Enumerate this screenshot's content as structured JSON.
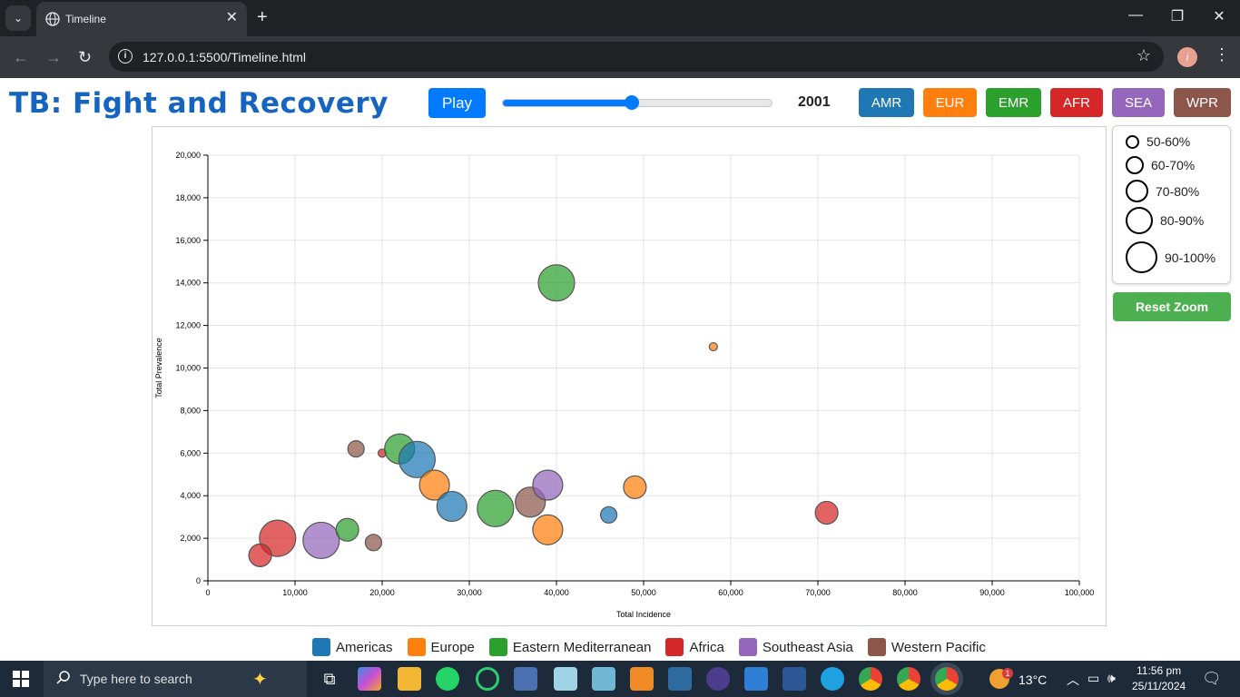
{
  "browser": {
    "tab_title": "Timeline",
    "url": "127.0.0.1:5500/Timeline.html"
  },
  "app": {
    "title": "TB: Fight and Recovery",
    "play_label": "Play",
    "year": "2001",
    "slider_fraction": 0.48,
    "reset_label": "Reset Zoom",
    "region_buttons": [
      {
        "label": "AMR",
        "color": "#1f77b4"
      },
      {
        "label": "EUR",
        "color": "#ff7f0e"
      },
      {
        "label": "EMR",
        "color": "#2ca02c"
      },
      {
        "label": "AFR",
        "color": "#d62728"
      },
      {
        "label": "SEA",
        "color": "#9467bd"
      },
      {
        "label": "WPR",
        "color": "#8c564b"
      }
    ],
    "size_legend": [
      "50-60%",
      "60-70%",
      "70-80%",
      "80-90%",
      "90-100%"
    ],
    "color_legend": [
      {
        "label": "Americas",
        "color": "#1f77b4"
      },
      {
        "label": "Europe",
        "color": "#ff7f0e"
      },
      {
        "label": "Eastern Mediterranean",
        "color": "#2ca02c"
      },
      {
        "label": "Africa",
        "color": "#d62728"
      },
      {
        "label": "Southeast Asia",
        "color": "#9467bd"
      },
      {
        "label": "Western Pacific",
        "color": "#8c564b"
      }
    ]
  },
  "chart_data": {
    "type": "scatter",
    "xlabel": "Total Incidence",
    "ylabel": "Total Prevalence",
    "xlim": [
      0,
      100000
    ],
    "ylim": [
      0,
      20000
    ],
    "grid": true,
    "x_ticks": [
      "0",
      "10,000",
      "20,000",
      "30,000",
      "40,000",
      "50,000",
      "60,000",
      "70,000",
      "80,000",
      "90,000",
      "100,000"
    ],
    "y_ticks": [
      "0",
      "2,000",
      "4,000",
      "6,000",
      "8,000",
      "10,000",
      "12,000",
      "14,000",
      "16,000",
      "18,000",
      "20,000"
    ],
    "points": [
      {
        "region": "EMR",
        "x": 40000,
        "y": 14000,
        "size": 5
      },
      {
        "region": "EUR",
        "x": 58000,
        "y": 11000,
        "size": 1
      },
      {
        "region": "WPR",
        "x": 17000,
        "y": 6200,
        "size": 2
      },
      {
        "region": "AFR",
        "x": 20000,
        "y": 6000,
        "size": 1
      },
      {
        "region": "EMR",
        "x": 22000,
        "y": 6200,
        "size": 4
      },
      {
        "region": "AMR",
        "x": 24000,
        "y": 5700,
        "size": 5
      },
      {
        "region": "EUR",
        "x": 26000,
        "y": 4500,
        "size": 4
      },
      {
        "region": "AMR",
        "x": 28000,
        "y": 3500,
        "size": 4
      },
      {
        "region": "EMR",
        "x": 33000,
        "y": 3400,
        "size": 5
      },
      {
        "region": "WPR",
        "x": 37000,
        "y": 3700,
        "size": 4
      },
      {
        "region": "SEA",
        "x": 39000,
        "y": 4500,
        "size": 4
      },
      {
        "region": "EUR",
        "x": 39000,
        "y": 2400,
        "size": 4
      },
      {
        "region": "AMR",
        "x": 46000,
        "y": 3100,
        "size": 2
      },
      {
        "region": "EUR",
        "x": 49000,
        "y": 4400,
        "size": 3
      },
      {
        "region": "AFR",
        "x": 71000,
        "y": 3200,
        "size": 3
      },
      {
        "region": "AFR",
        "x": 8000,
        "y": 2000,
        "size": 5
      },
      {
        "region": "SEA",
        "x": 13000,
        "y": 1900,
        "size": 5
      },
      {
        "region": "EMR",
        "x": 16000,
        "y": 2400,
        "size": 3
      },
      {
        "region": "WPR",
        "x": 19000,
        "y": 1800,
        "size": 2
      },
      {
        "region": "AFR",
        "x": 6000,
        "y": 1200,
        "size": 3
      }
    ]
  },
  "taskbar": {
    "search_placeholder": "Type here to search",
    "temperature": "13°C",
    "time": "11:56 pm",
    "date": "25/11/2024",
    "weather_badge": "1"
  }
}
